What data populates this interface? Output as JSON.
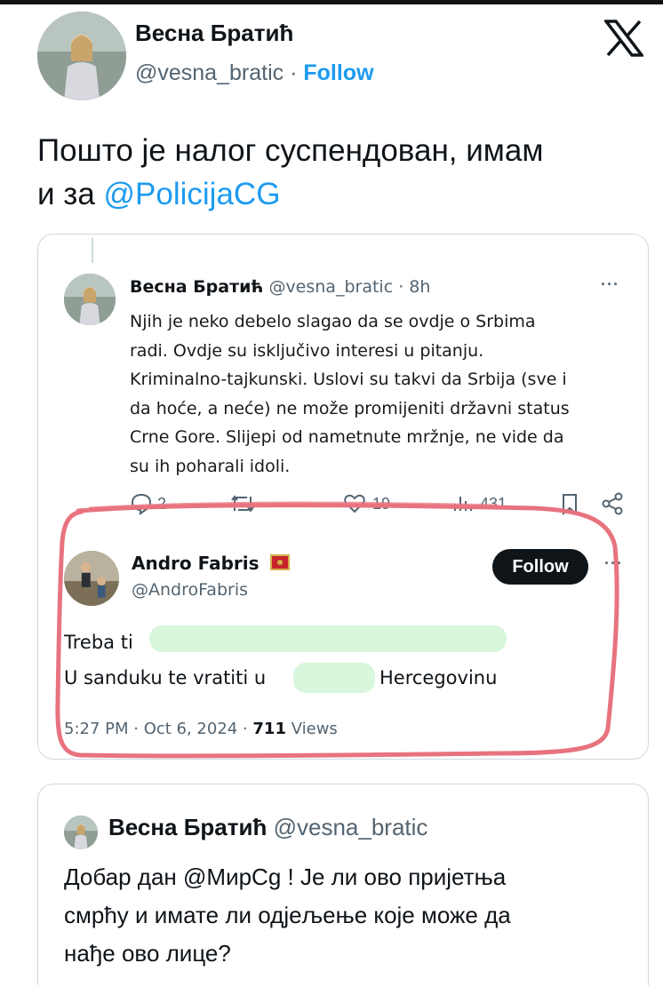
{
  "author": {
    "name": "Весна Братић",
    "handle": "@vesna_bratic",
    "separator": "·",
    "follow_label": "Follow"
  },
  "main_tweet": {
    "text_line1": "Пошто је налог суспендован, имам",
    "text_line2_prefix": "и за ",
    "text_line2_mention": "@PolicijaCG"
  },
  "quoted_tweet": {
    "name": "Весна Братић",
    "handle": "@vesna_bratic",
    "time": "· 8h",
    "more": "···",
    "lines": [
      "Njih  je neko debelo slagao da se ovdje o Srbima",
      "radi. Ovdje su isključivo interesi u pitanju.",
      "Kriminalno-tajkunski. Uslovi su takvi da Srbija (sve i",
      "da hoće, a neće) ne može promijeniti državni status",
      "Crne Gore. Slijepi od nametnute mržnje, ne vide da",
      "su ih poharali  idoli."
    ],
    "stats": {
      "replies": "2",
      "likes": "19",
      "views": "431"
    }
  },
  "reply_tweet": {
    "name": "Andro Fabris",
    "handle": "@AndroFabris",
    "follow_label": "Follow",
    "more": "···",
    "line1": "Treba ti",
    "line2_a": "U sanduku te vratiti u",
    "line2_b": "Hercegovinu",
    "time": "5:27 PM · Oct 6, 2024 · ",
    "views_count": "711",
    "views_label": " Views"
  },
  "bottom_tweet": {
    "name": "Весна Братић",
    "handle": "@vesna_bratic",
    "lines": [
      "Добар дан @МирСg ! Је ли ово пријетња",
      "смрћу и имате ли одјељење које може да",
      "нађе ово лице?"
    ]
  },
  "colors": {
    "link": "#1d9bf0",
    "muted": "#536471",
    "circle_markup": "#e8737f",
    "highlight": "#d9f7dd"
  },
  "icons": [
    "x-logo-icon",
    "reply-icon",
    "retweet-icon",
    "like-icon",
    "views-icon",
    "bookmark-icon",
    "share-icon",
    "flag-icon",
    "more-icon"
  ]
}
